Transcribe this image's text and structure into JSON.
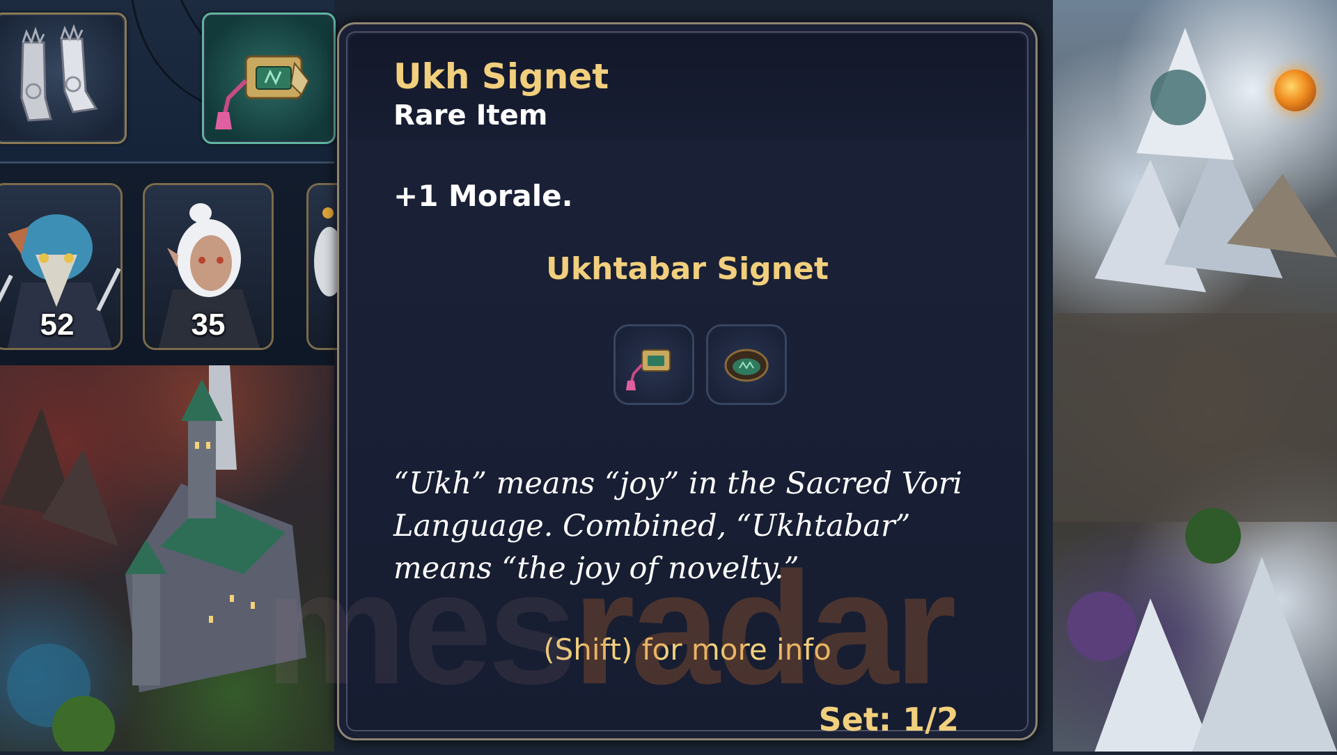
{
  "heroes": [
    {
      "count": "52"
    },
    {
      "count": "35"
    }
  ],
  "tooltip": {
    "item_name": "Ukh Signet",
    "rarity": "Rare Item",
    "effect": "+1 Morale.",
    "set_name": "Ukhtabar Signet",
    "set_item_icons": [
      "signet-icon",
      "ring-icon"
    ],
    "lore": "“Ukh” means “joy” in the Sacred Vori Language. Combined, “Ukhtabar” means “the joy of novelty.”",
    "more_info": "(Shift) for more info",
    "set_progress": "Set: 1/2"
  },
  "watermark": {
    "part_a": "mes",
    "part_b": "radar"
  },
  "colors": {
    "gold_text": "#f1cf7d",
    "tooltip_bg": "#1b2137",
    "tooltip_border": "#8e8672",
    "selected_slot_border": "#5fb6a0"
  }
}
